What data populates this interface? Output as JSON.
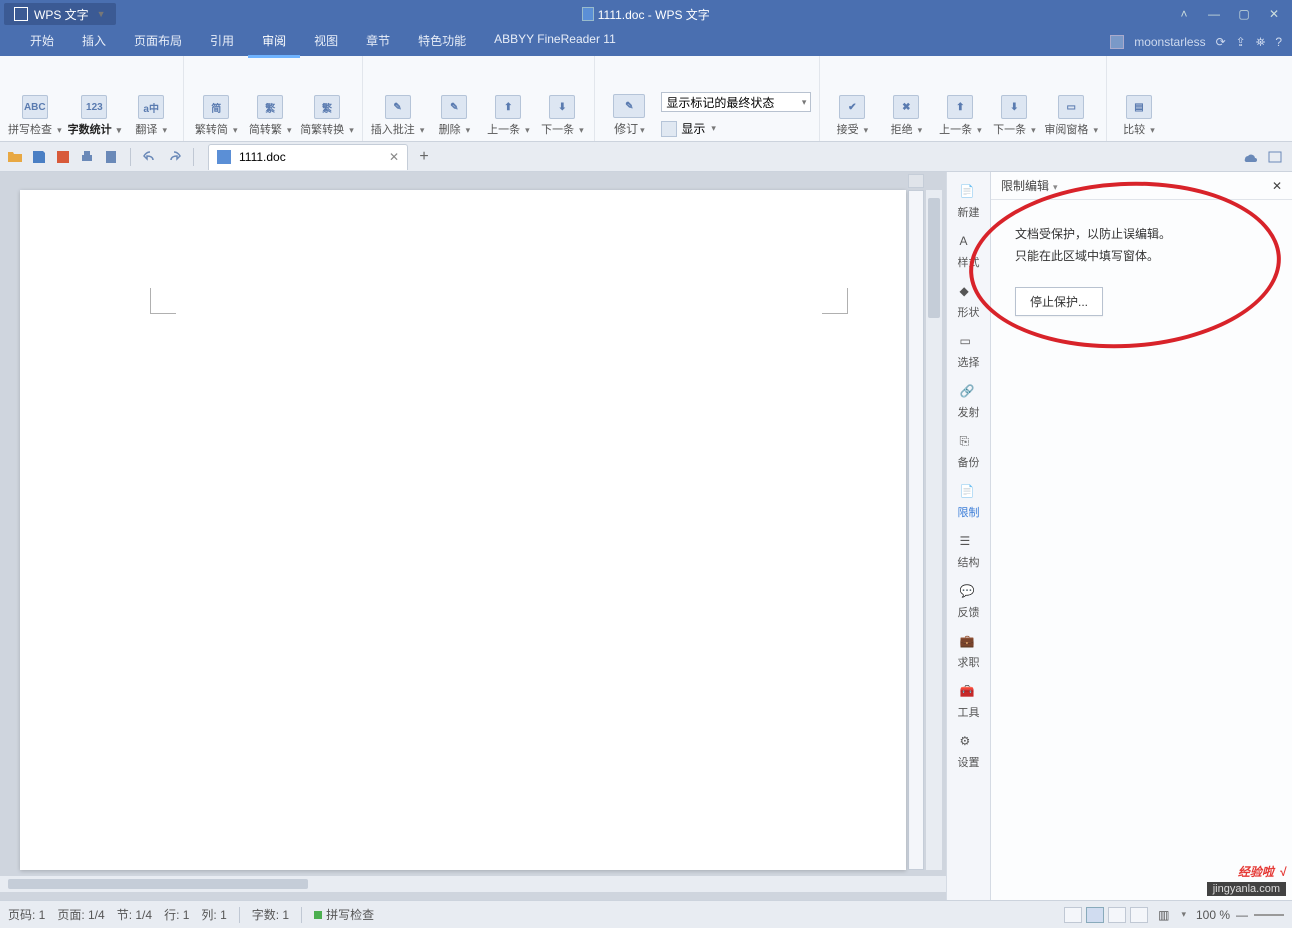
{
  "app": {
    "name": "WPS 文字",
    "title": "1111.doc - WPS 文字"
  },
  "window_user": "moonstarless",
  "menubar": {
    "items": [
      "开始",
      "插入",
      "页面布局",
      "引用",
      "审阅",
      "视图",
      "章节",
      "特色功能",
      "ABBYY FineReader 11"
    ],
    "active_index": 4
  },
  "ribbon": {
    "g1": [
      {
        "label": "拼写检查",
        "icon": "ABC"
      },
      {
        "label": "字数统计",
        "icon": "123",
        "bold": true
      },
      {
        "label": "翻译",
        "icon": "a中"
      }
    ],
    "g2": [
      {
        "label": "繁转简",
        "icon": "简"
      },
      {
        "label": "简转繁",
        "icon": "繁"
      },
      {
        "label": "简繁转换",
        "icon": "繁"
      }
    ],
    "g3": [
      {
        "label": "插入批注",
        "icon": "✎"
      },
      {
        "label": "删除",
        "icon": "✎"
      },
      {
        "label": "上一条",
        "icon": "⬆"
      },
      {
        "label": "下一条",
        "icon": "⬇"
      }
    ],
    "g4": {
      "track": "修订",
      "combo": "显示标记的最终状态",
      "show": "显示"
    },
    "g5": [
      {
        "label": "接受",
        "icon": "✔"
      },
      {
        "label": "拒绝",
        "icon": "✖"
      },
      {
        "label": "上一条",
        "icon": "⬆"
      },
      {
        "label": "下一条",
        "icon": "⬇"
      },
      {
        "label": "审阅窗格",
        "icon": "▭"
      }
    ],
    "g6": [
      {
        "label": "比较",
        "icon": "▤"
      }
    ]
  },
  "tabbar": {
    "doc": "1111.doc"
  },
  "side": [
    {
      "label": "新建",
      "name": "new"
    },
    {
      "label": "样式",
      "name": "styles"
    },
    {
      "label": "形状",
      "name": "shapes"
    },
    {
      "label": "选择",
      "name": "select"
    },
    {
      "label": "发射",
      "name": "send"
    },
    {
      "label": "备份",
      "name": "backup"
    },
    {
      "label": "限制",
      "name": "restrict",
      "active": true
    },
    {
      "label": "结构",
      "name": "structure"
    },
    {
      "label": "反馈",
      "name": "feedback"
    },
    {
      "label": "求职",
      "name": "job"
    },
    {
      "label": "工具",
      "name": "tools"
    },
    {
      "label": "设置",
      "name": "settings"
    }
  ],
  "rightpane": {
    "title": "限制编辑",
    "msg1": "文档受保护，以防止误编辑。",
    "msg2": "只能在此区域中填写窗体。",
    "button": "停止保护..."
  },
  "status": {
    "page_no": "页码: 1",
    "page": "页面: 1/4",
    "section": "节: 1/4",
    "line": "行: 1",
    "col": "列: 1",
    "words": "字数: 1",
    "spell": "拼写检查",
    "zoom": "100 %"
  },
  "watermark": {
    "line1": "经验啦",
    "check": "√",
    "line2": "jingyanla.com"
  }
}
